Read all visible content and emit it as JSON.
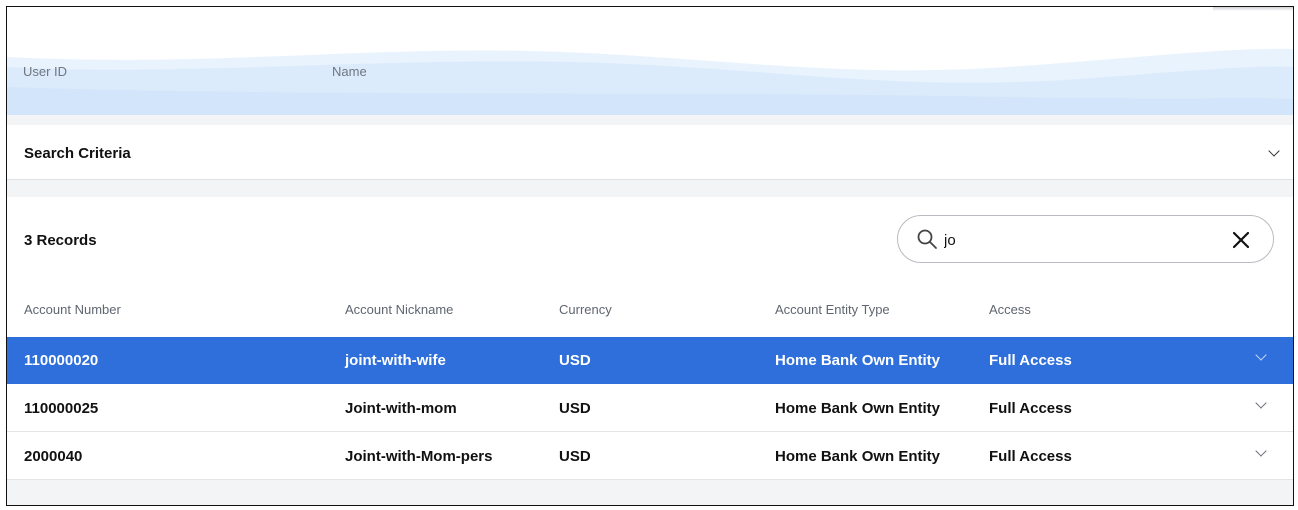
{
  "header": {
    "user_id_label": "User ID",
    "name_label": "Name"
  },
  "search_criteria": {
    "title": "Search Criteria"
  },
  "records": {
    "count_label": "3 Records",
    "search_value": "jo",
    "columns": [
      "Account Number",
      "Account Nickname",
      "Currency",
      "Account Entity Type",
      "Access"
    ],
    "rows": [
      {
        "account_number": "110000020",
        "nickname": "joint-with-wife",
        "currency": "USD",
        "entity_type": "Home Bank Own Entity",
        "access": "Full Access",
        "selected": true
      },
      {
        "account_number": "110000025",
        "nickname": "Joint-with-mom",
        "currency": "USD",
        "entity_type": "Home Bank Own Entity",
        "access": "Full Access",
        "selected": false
      },
      {
        "account_number": "2000040",
        "nickname": "Joint-with-Mom-pers",
        "currency": "USD",
        "entity_type": "Home Bank Own Entity",
        "access": "Full Access",
        "selected": false
      }
    ]
  },
  "colors": {
    "selected_row": "#2e6fdb",
    "header_wave": "#dcebfb"
  },
  "icons": {
    "search": "search-icon",
    "clear": "close-icon",
    "expand": "chevron-down-icon"
  }
}
